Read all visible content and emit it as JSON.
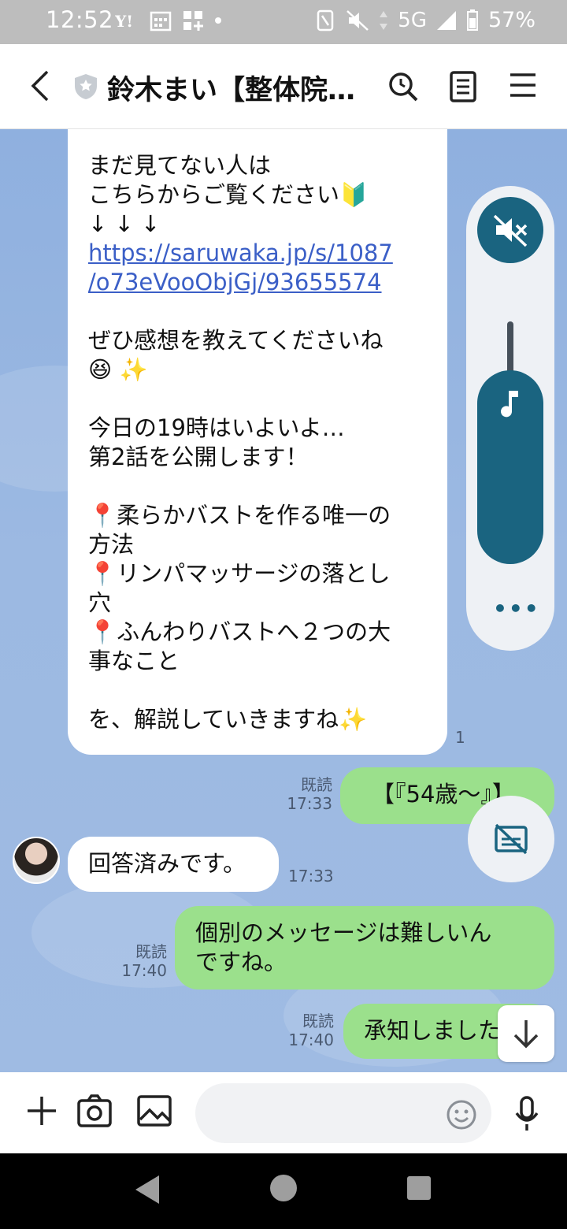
{
  "status_bar": {
    "time": "12:52",
    "network": "5G",
    "battery": "57%"
  },
  "header": {
    "title": "鈴木まい【整体院…"
  },
  "messages": {
    "bubble1_lines": [
      "まだ見てない人は",
      "こちらからご覧ください🔰",
      "↓ ↓ ↓",
      "https://saruwaka.jp/s/1087",
      "/o73eVooObjGj/93655574",
      "",
      "ぜひ感想を教えてくださいね",
      "😆 ✨",
      "",
      "今日の19時はいよいよ…",
      "第2話を公開します！",
      "",
      "📍柔らかバストを作る唯一の",
      "方法",
      "📍リンパマッサージの落とし",
      "穴",
      "📍ふんわりバストへ２つの大",
      "事なこと",
      "",
      "を、解説していきますね✨"
    ],
    "bubble1_time_partial": "1",
    "out1": {
      "text": "【『54歳〜』】",
      "read": "既読",
      "time": "17:33"
    },
    "in2": {
      "text": "回答済みです。",
      "time": "17:33"
    },
    "out2": {
      "line1": "個別のメッセージは難しいん",
      "line2": "ですね。",
      "read": "既読",
      "time": "17:40"
    },
    "out3": {
      "text": "承知しました",
      "read": "既読",
      "time": "17:40"
    }
  },
  "input": {
    "placeholder": ""
  },
  "colors": {
    "chat_bg": "#9cb9e2",
    "out_bubble": "#9be08c",
    "accent": "#1a6480"
  }
}
